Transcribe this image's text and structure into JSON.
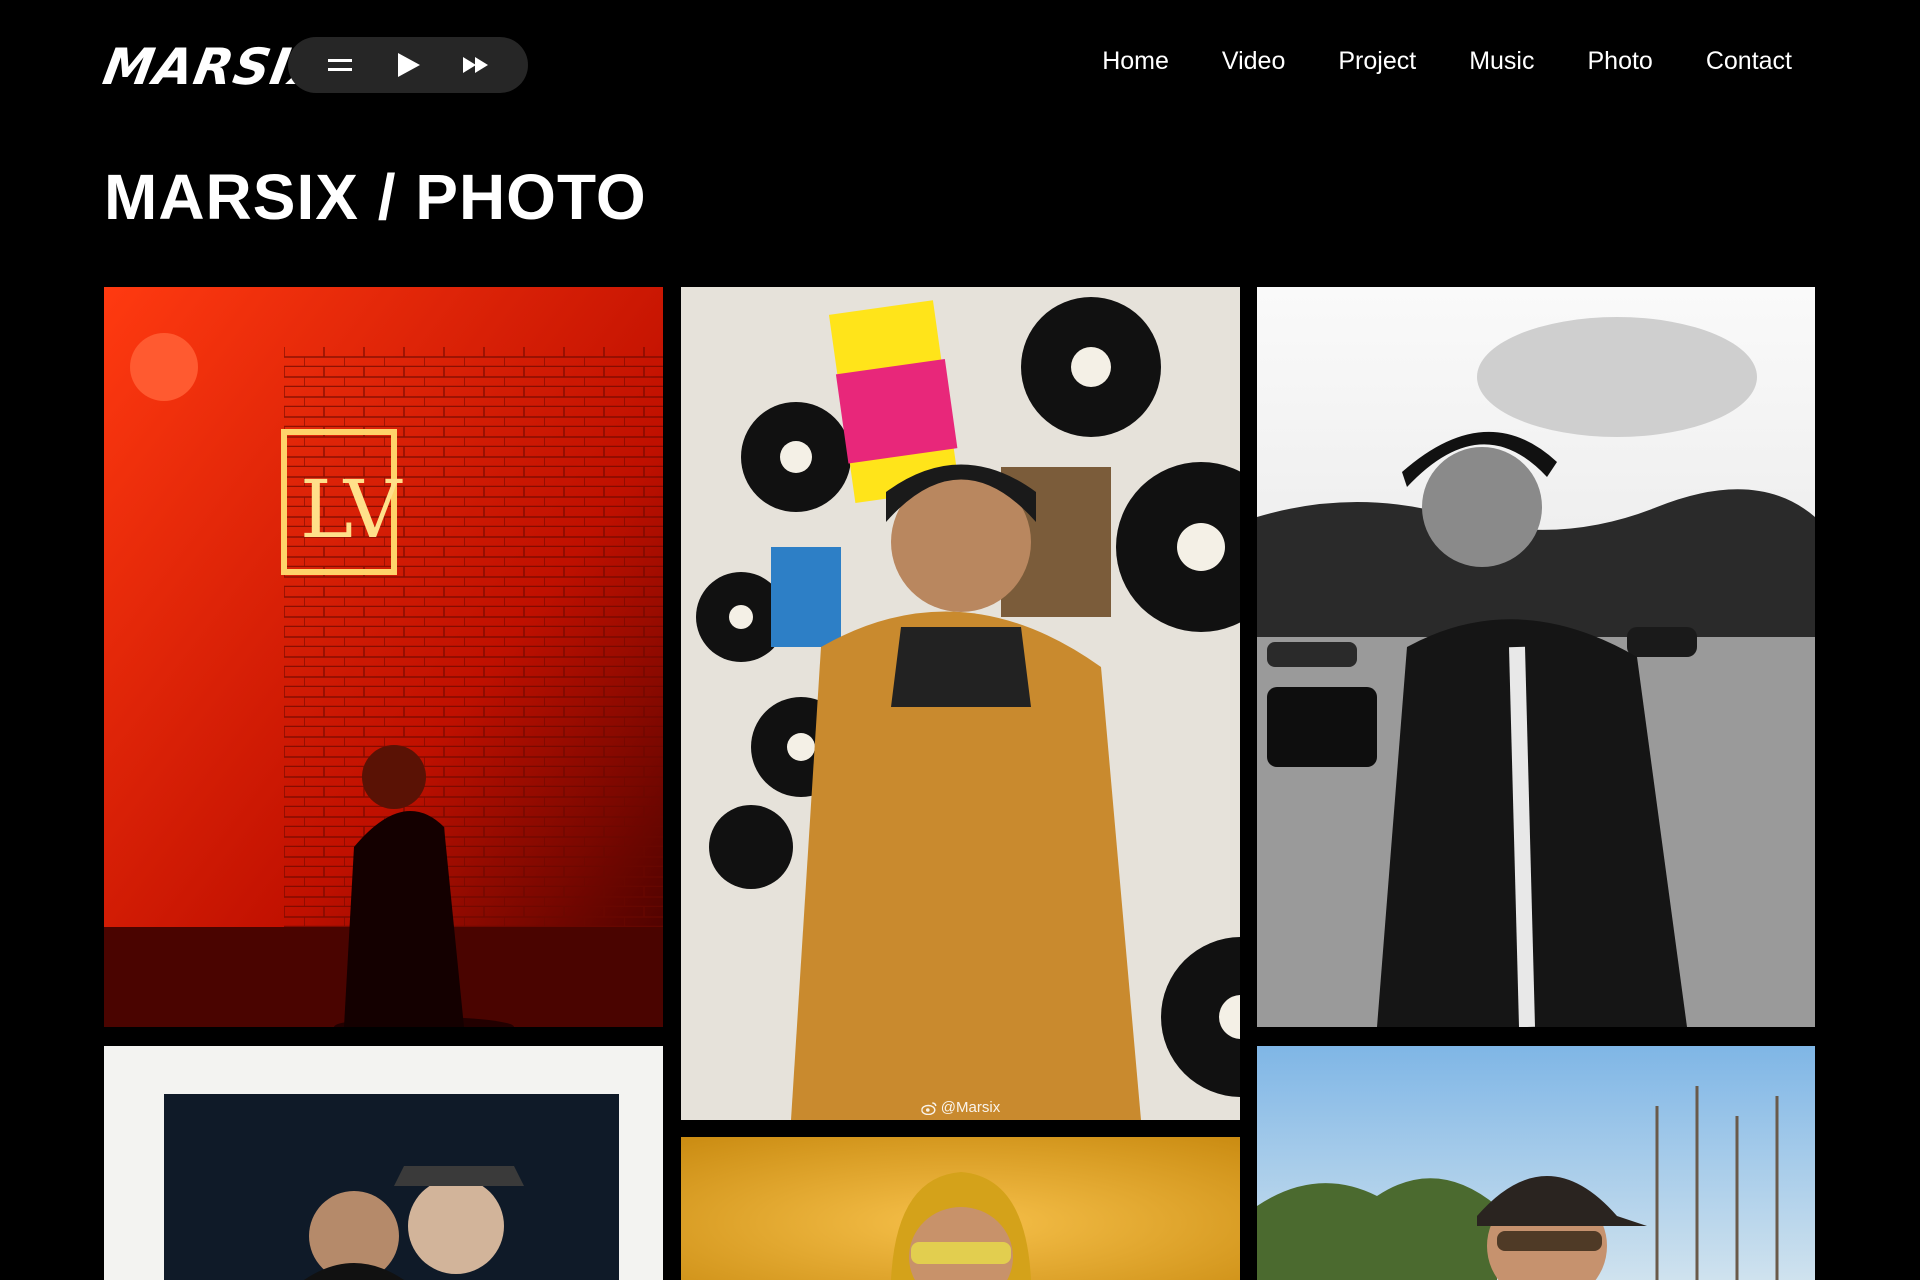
{
  "brand": {
    "logo_text": "MARSIX"
  },
  "player": {
    "menu_icon": "hamburger-icon",
    "play_icon": "play-icon",
    "next_icon": "fast-forward-icon"
  },
  "nav": {
    "items": [
      {
        "label": "Home"
      },
      {
        "label": "Video"
      },
      {
        "label": "Project"
      },
      {
        "label": "Music"
      },
      {
        "label": "Photo"
      },
      {
        "label": "Contact"
      }
    ]
  },
  "page": {
    "title": "MARSIX / PHOTO"
  },
  "gallery": {
    "photos": [
      {
        "name": "red-neon-brick-wall-photo",
        "palette": [
          "#ff2a00",
          "#7a0a00",
          "#2a0000"
        ]
      },
      {
        "name": "vinyl-wall-yellow-jacket-photo",
        "palette": [
          "#e8e6e0",
          "#c98a2e",
          "#111111"
        ],
        "watermark": "@Marsix"
      },
      {
        "name": "bw-camera-field-photo",
        "palette": [
          "#f0f0f0",
          "#8a8a8a",
          "#1a1a1a"
        ]
      },
      {
        "name": "polaroid-two-men-photo",
        "palette": [
          "#f4f4f2",
          "#1b2a3a",
          "#2a2a2a"
        ]
      },
      {
        "name": "yellow-beanie-portrait-photo",
        "palette": [
          "#f0b02a",
          "#c98a10",
          "#2a2a2a"
        ]
      },
      {
        "name": "park-cap-sunglasses-photo",
        "palette": [
          "#9fc6ea",
          "#5a7a3a",
          "#2a2a2a"
        ]
      }
    ]
  },
  "colors": {
    "background": "#000000",
    "player_bg": "#262626",
    "text": "#ffffff"
  }
}
